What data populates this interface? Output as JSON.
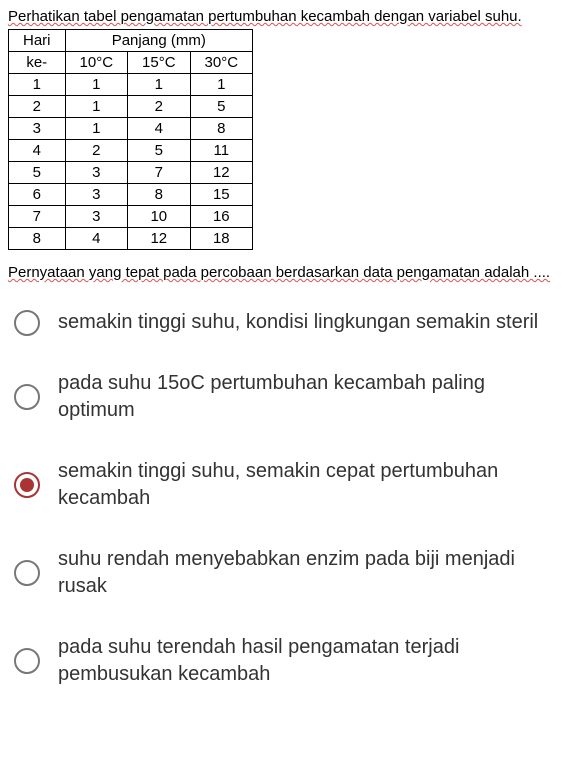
{
  "intro": "Perhatikan tabel pengamatan pertumbuhan kecambah dengan variabel suhu.",
  "table": {
    "row_header_top": "Hari",
    "row_header_bottom": "ke-",
    "col_group": "Panjang (mm)",
    "cols": [
      "10°C",
      "15°C",
      "30°C"
    ],
    "rows": [
      [
        "1",
        "1",
        "1",
        "1"
      ],
      [
        "2",
        "1",
        "2",
        "5"
      ],
      [
        "3",
        "1",
        "4",
        "8"
      ],
      [
        "4",
        "2",
        "5",
        "11"
      ],
      [
        "5",
        "3",
        "7",
        "12"
      ],
      [
        "6",
        "3",
        "8",
        "15"
      ],
      [
        "7",
        "3",
        "10",
        "16"
      ],
      [
        "8",
        "4",
        "12",
        "18"
      ]
    ]
  },
  "question": "Pernyataan yang tepat pada percobaan berdasarkan data pengamatan adalah ....",
  "options": [
    {
      "text": "semakin tinggi suhu, kondisi lingkungan semakin steril",
      "selected": false
    },
    {
      "text": "pada suhu 15oC pertumbuhan kecambah paling optimum",
      "selected": false
    },
    {
      "text": "semakin tinggi suhu, semakin cepat pertumbuhan kecambah",
      "selected": true
    },
    {
      "text": "suhu rendah menyebabkan enzim pada biji menjadi rusak",
      "selected": false
    },
    {
      "text": "pada suhu terendah hasil pengamatan terjadi pembusukan kecambah",
      "selected": false
    }
  ]
}
